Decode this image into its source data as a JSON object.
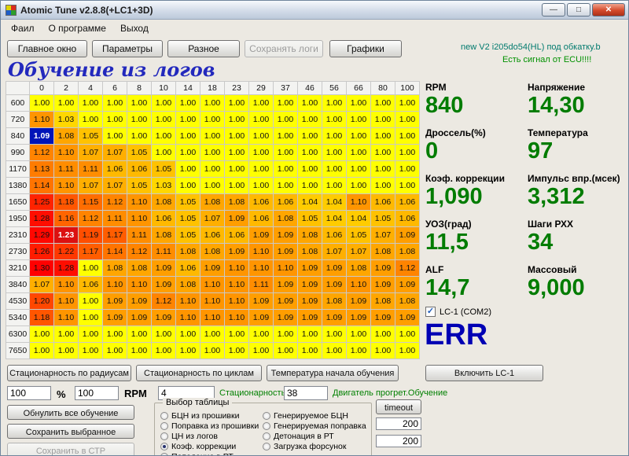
{
  "window": {
    "title": "Atomic Tune  v2.8.8(+LC1+3D)",
    "icons": {
      "minimize": "—",
      "maximize": "□",
      "close": "✕"
    },
    "menu": [
      "Фаил",
      "О программе",
      "Выход"
    ],
    "toolbar": [
      {
        "label": "Главное окно",
        "enabled": true
      },
      {
        "label": "Параметры",
        "enabled": true
      },
      {
        "label": "Разное",
        "enabled": true
      },
      {
        "label": "Сохранять логи",
        "enabled": false
      },
      {
        "label": "Графики",
        "enabled": true
      }
    ],
    "status": {
      "firmware": "new V2  i205do54(HL) под обкатку.b",
      "ecu_signal": "Есть сигнал от ECU!!!!"
    }
  },
  "heading": "Обучение из логов",
  "table": {
    "col_headers": [
      "0",
      "2",
      "4",
      "6",
      "8",
      "10",
      "14",
      "18",
      "23",
      "29",
      "37",
      "46",
      "56",
      "66",
      "80",
      "100"
    ],
    "row_headers": [
      "600",
      "720",
      "840",
      "990",
      "1170",
      "1380",
      "1650",
      "1950",
      "2310",
      "2730",
      "3210",
      "3840",
      "4530",
      "5340",
      "6300",
      "7650"
    ],
    "rows": [
      [
        1.0,
        1.0,
        1.0,
        1.0,
        1.0,
        1.0,
        1.0,
        1.0,
        1.0,
        1.0,
        1.0,
        1.0,
        1.0,
        1.0,
        1.0,
        1.0
      ],
      [
        1.1,
        1.03,
        1.0,
        1.0,
        1.0,
        1.0,
        1.0,
        1.0,
        1.0,
        1.0,
        1.0,
        1.0,
        1.0,
        1.0,
        1.0,
        1.0
      ],
      [
        1.09,
        1.08,
        1.05,
        1.0,
        1.0,
        1.0,
        1.0,
        1.0,
        1.0,
        1.0,
        1.0,
        1.0,
        1.0,
        1.0,
        1.0,
        1.0
      ],
      [
        1.12,
        1.1,
        1.07,
        1.07,
        1.05,
        1.0,
        1.0,
        1.0,
        1.0,
        1.0,
        1.0,
        1.0,
        1.0,
        1.0,
        1.0,
        1.0
      ],
      [
        1.13,
        1.11,
        1.11,
        1.06,
        1.06,
        1.05,
        1.0,
        1.0,
        1.0,
        1.0,
        1.0,
        1.0,
        1.0,
        1.0,
        1.0,
        1.0
      ],
      [
        1.14,
        1.1,
        1.07,
        1.07,
        1.05,
        1.03,
        1.0,
        1.0,
        1.0,
        1.0,
        1.0,
        1.0,
        1.0,
        1.0,
        1.0,
        1.0
      ],
      [
        1.25,
        1.18,
        1.15,
        1.12,
        1.1,
        1.08,
        1.05,
        1.08,
        1.08,
        1.06,
        1.06,
        1.04,
        1.04,
        1.1,
        1.06,
        1.06
      ],
      [
        1.28,
        1.16,
        1.12,
        1.11,
        1.1,
        1.06,
        1.05,
        1.07,
        1.09,
        1.06,
        1.08,
        1.05,
        1.04,
        1.04,
        1.05,
        1.06
      ],
      [
        1.29,
        1.23,
        1.19,
        1.17,
        1.11,
        1.08,
        1.05,
        1.06,
        1.06,
        1.09,
        1.09,
        1.08,
        1.06,
        1.05,
        1.07,
        1.09
      ],
      [
        1.26,
        1.22,
        1.17,
        1.14,
        1.12,
        1.11,
        1.08,
        1.08,
        1.09,
        1.1,
        1.09,
        1.08,
        1.07,
        1.07,
        1.08,
        1.08
      ],
      [
        1.3,
        1.28,
        1.0,
        1.08,
        1.08,
        1.09,
        1.06,
        1.09,
        1.1,
        1.1,
        1.1,
        1.09,
        1.09,
        1.08,
        1.09,
        1.12
      ],
      [
        1.07,
        1.1,
        1.06,
        1.1,
        1.1,
        1.09,
        1.08,
        1.1,
        1.1,
        1.11,
        1.09,
        1.09,
        1.09,
        1.1,
        1.09,
        1.09
      ],
      [
        1.2,
        1.1,
        1.0,
        1.09,
        1.09,
        1.12,
        1.1,
        1.1,
        1.1,
        1.09,
        1.09,
        1.09,
        1.08,
        1.09,
        1.08,
        1.08
      ],
      [
        1.18,
        1.1,
        1.0,
        1.09,
        1.09,
        1.09,
        1.1,
        1.1,
        1.1,
        1.09,
        1.09,
        1.09,
        1.09,
        1.09,
        1.09,
        1.09
      ],
      [
        1.0,
        1.0,
        1.0,
        1.0,
        1.0,
        1.0,
        1.0,
        1.0,
        1.0,
        1.0,
        1.0,
        1.0,
        1.0,
        1.0,
        1.0,
        1.0
      ],
      [
        1.0,
        1.0,
        1.0,
        1.0,
        1.0,
        1.0,
        1.0,
        1.0,
        1.0,
        1.0,
        1.0,
        1.0,
        1.0,
        1.0,
        1.0,
        1.0
      ]
    ],
    "selected_cell": {
      "row": 2,
      "col": 0
    },
    "active_cell": {
      "row": 8,
      "col": 1
    },
    "colors": {
      "min": "#FFFF00",
      "max": "#FF0000",
      "selected": "#0014B8",
      "active": "#DC1010"
    }
  },
  "gauges": {
    "left": [
      {
        "label": "RPM",
        "value": "840"
      },
      {
        "label": "Дроссель(%)",
        "value": "0"
      },
      {
        "label": "Коэф. коррекции",
        "value": "1,090"
      },
      {
        "label": "УОЗ(град)",
        "value": "11,5"
      },
      {
        "label": "ALF",
        "value": "14,7"
      }
    ],
    "right": [
      {
        "label": "Напряжение",
        "value": "14,30"
      },
      {
        "label": "Температура",
        "value": "97"
      },
      {
        "label": "Импульс впр.(мсек)",
        "value": "3,312"
      },
      {
        "label": "Шаги РХХ",
        "value": "34"
      },
      {
        "label": "Массовый",
        "value": "9,000"
      }
    ],
    "value_color": "#007C00"
  },
  "lc1": {
    "checkbox_label": "LC-1 (COM2)",
    "checked": true,
    "check_glyph": "✓",
    "status": "ERR",
    "status_color": "#0000B4",
    "enable_button": "Включить LC-1"
  },
  "controls": {
    "stationarity_radius_button": "Стационарность по радиусам",
    "stationarity_cycles_button": "Стационарность по циклам",
    "temp_start_button": "Температура начала обучения",
    "percent_value": "100",
    "percent_label": "%",
    "rpm_value": "100",
    "rpm_label": "RPM",
    "stationarity_value": "4",
    "stationarity_label": "Стационарность",
    "engine_warm_value": "38",
    "engine_warm_label": "Двигатель прогрет.Обучение",
    "reset_button": "Обнулить все обучение",
    "save_selected_button": "Сохранить выбранное",
    "save_str_button": "Сохранить в СТР",
    "timeout_button": "timeout",
    "timeout_value1": "200",
    "timeout_value2": "200"
  },
  "table_select": {
    "title": "Выбор таблицы",
    "options_left": [
      "БЦН из прошивки",
      "Поправка из прошивки",
      "ЦН из логов",
      "Коэф. коррекции",
      "Попадание в РТ"
    ],
    "options_right": [
      "Генерируемое БЦН",
      "Генерируемая поправка",
      "Детонация в РТ",
      "Загрузка форсунок"
    ],
    "selected": "Коэф. коррекции"
  }
}
